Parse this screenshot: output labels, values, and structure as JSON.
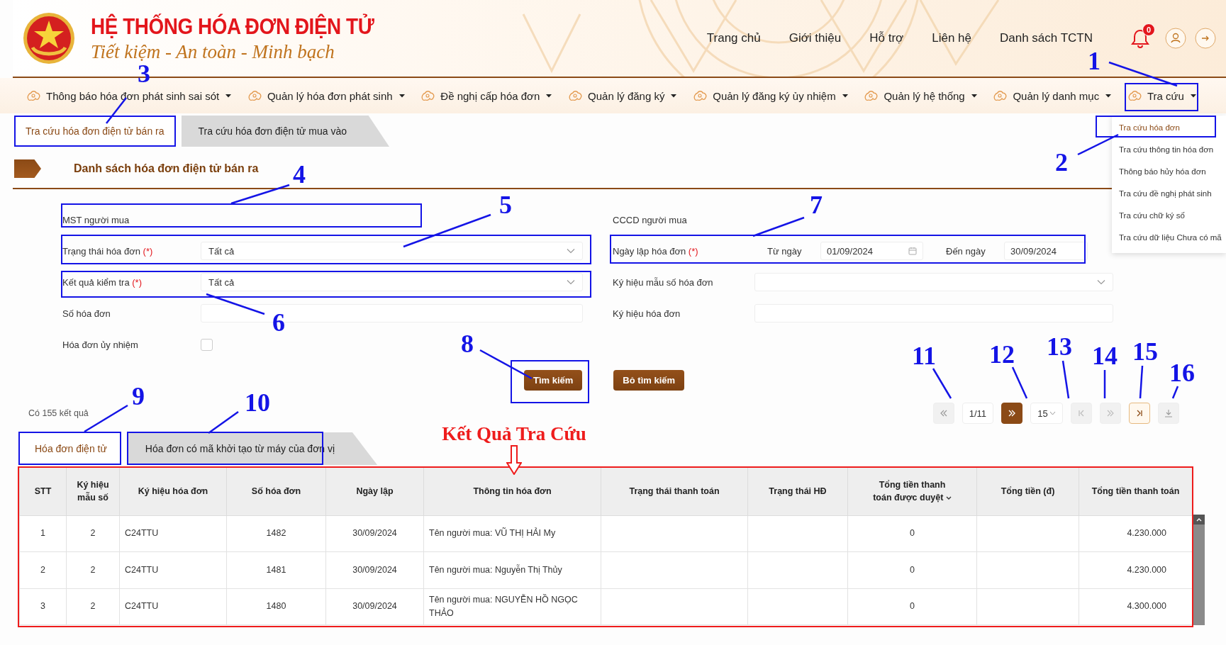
{
  "header": {
    "title": "HỆ THỐNG HÓA ĐƠN ĐIỆN TỬ",
    "slogan": "Tiết kiệm - An toàn - Minh bạch",
    "nav": [
      "Trang chủ",
      "Giới thiệu",
      "Hỗ trợ",
      "Liên hệ",
      "Danh sách TCTN"
    ],
    "notification_count": "0"
  },
  "menu": {
    "items": [
      "Thông báo hóa đơn phát sinh sai sót",
      "Quản lý hóa đơn phát sinh",
      "Đề nghị cấp hóa đơn",
      "Quản lý đăng ký",
      "Quản lý đăng ký ủy nhiệm",
      "Quản lý hệ thống",
      "Quản lý danh mục",
      "Tra cứu"
    ]
  },
  "lookup_menu": {
    "items": [
      {
        "label": "Tra cứu hóa đơn",
        "selected": true
      },
      {
        "label": "Tra cứu thông tin hóa đơn",
        "selected": false
      },
      {
        "label": "Thông báo hủy hóa đơn",
        "selected": false
      },
      {
        "label": "Tra cứu đề nghị phát sinh",
        "selected": false
      },
      {
        "label": "Tra cứu chữ ký số",
        "selected": false
      },
      {
        "label": "Tra cứu dữ liệu Chưa có mã",
        "selected": false
      }
    ]
  },
  "page_tabs": [
    {
      "label": "Tra cứu hóa đơn điện tử bán ra",
      "selected": true
    },
    {
      "label": "Tra cứu hóa đơn điện tử mua vào",
      "selected": false
    }
  ],
  "section_title": "Danh sách hóa đơn điện tử bán ra",
  "form": {
    "left": [
      {
        "kind": "label",
        "label": "MST người mua"
      },
      {
        "kind": "select",
        "label": "Trạng thái hóa đơn",
        "required_mark": "(*)",
        "value": "Tất cả"
      },
      {
        "kind": "select",
        "label": "Kết quả kiểm tra",
        "required_mark": "(*)",
        "value": "Tất cả"
      },
      {
        "kind": "text",
        "label": "Số hóa đơn"
      },
      {
        "kind": "checkbox",
        "label": "Hóa đơn ủy nhiệm",
        "checked": false
      }
    ],
    "right": [
      {
        "kind": "label",
        "label": "CCCD người mua"
      },
      {
        "kind": "daterange",
        "label": "Ngày lập hóa đơn",
        "required_mark": "(*)",
        "from_label": "Từ ngày",
        "from_value": "01/09/2024",
        "to_label": "Đến ngày",
        "to_value": "30/09/2024"
      },
      {
        "kind": "select",
        "label": "Ký hiệu mẫu số hóa đơn"
      },
      {
        "kind": "text",
        "label": "Ký hiệu hóa đơn"
      }
    ]
  },
  "buttons": [
    "Tìm kiếm",
    "Bỏ tìm kiếm"
  ],
  "result_count": "Có 155 kết quả",
  "pagination": [
    {
      "kind": "prev",
      "disabled": true
    },
    {
      "kind": "page",
      "text": "1/11"
    },
    {
      "kind": "next",
      "disabled": false
    },
    {
      "kind": "size",
      "text": "15"
    },
    {
      "kind": "first",
      "disabled": true
    },
    {
      "kind": "step",
      "disabled": true
    },
    {
      "kind": "last",
      "disabled": false
    },
    {
      "kind": "download",
      "disabled": true
    }
  ],
  "result_tabs": [
    {
      "label": "Hóa đơn điện tử",
      "selected": true
    },
    {
      "label": "Hóa đơn có mã khởi tạo từ máy của đơn vị",
      "selected": false
    }
  ],
  "table": {
    "columns": [
      {
        "label": "STT",
        "sorted": false
      },
      {
        "label": "Ký hiệu mẫu số",
        "sorted": false
      },
      {
        "label": "Ký hiệu hóa đơn",
        "sorted": false
      },
      {
        "label": "Số hóa đơn",
        "sorted": false
      },
      {
        "label": "Ngày lập",
        "sorted": false
      },
      {
        "label": "Thông tin hóa đơn",
        "sorted": false
      },
      {
        "label": "Trạng thái thanh toán",
        "sorted": false
      },
      {
        "label": "Trạng thái HĐ",
        "sorted": false
      },
      {
        "label": "Tổng tiền thanh toán được duyệt",
        "sorted": true
      },
      {
        "label": "Tổng tiền (đ)",
        "sorted": false
      },
      {
        "label": "Tổng tiền thanh toán",
        "sorted": false
      }
    ],
    "rows": [
      [
        "1",
        "2",
        "C24TTU",
        "1482",
        "30/09/2024",
        "Tên người mua: VŨ THỊ HẢI My",
        null,
        null,
        "0",
        null,
        "4.230.000"
      ],
      [
        "2",
        "2",
        "C24TTU",
        "1481",
        "30/09/2024",
        "Tên người mua: Nguyễn Thị Thủy",
        null,
        null,
        "0",
        null,
        "4.230.000"
      ],
      [
        "3",
        "2",
        "C24TTU",
        "1480",
        "30/09/2024",
        "Tên người mua: NGUYỄN HỒ NGỌC THẢO",
        null,
        null,
        "0",
        null,
        "4.300.000"
      ]
    ]
  },
  "annotations": {
    "callouts": [
      {
        "number": "1"
      },
      {
        "number": "2"
      },
      {
        "number": "3"
      },
      {
        "number": "4"
      },
      {
        "number": "5"
      },
      {
        "number": "6"
      },
      {
        "number": "7"
      },
      {
        "number": "8"
      },
      {
        "number": "9"
      },
      {
        "number": "10"
      },
      {
        "number": "11"
      },
      {
        "number": "12"
      },
      {
        "number": "13"
      },
      {
        "number": "14"
      },
      {
        "number": "15"
      },
      {
        "number": "16"
      }
    ],
    "highlight_title": "Kết Quả Tra Cứu"
  }
}
